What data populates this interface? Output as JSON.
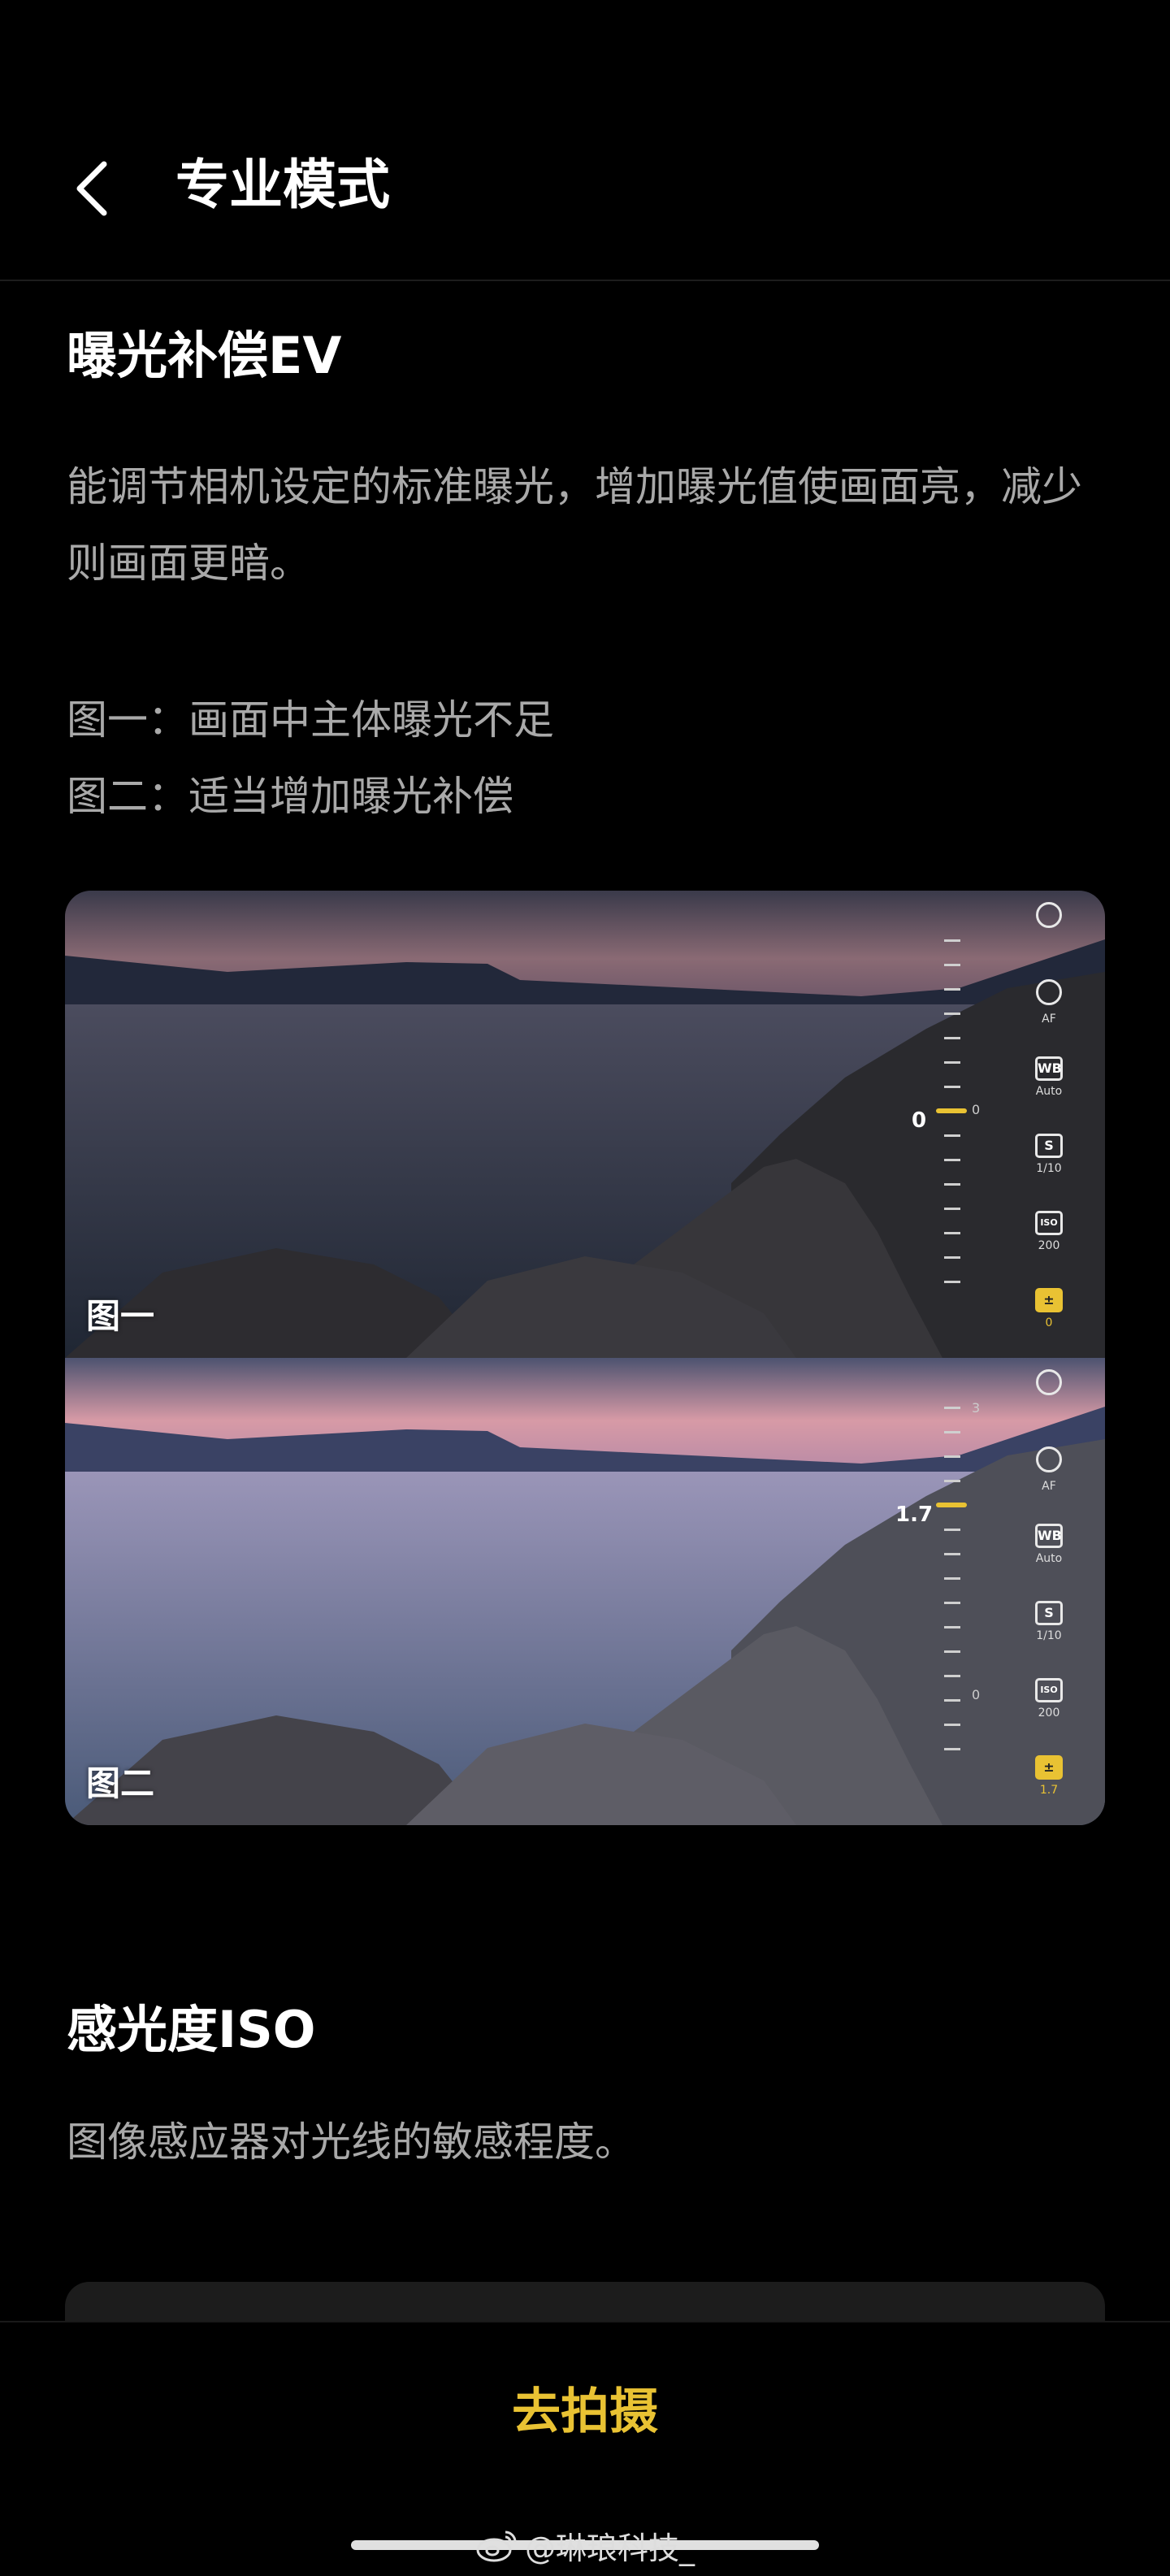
{
  "header": {
    "title": "专业模式"
  },
  "exposure": {
    "title": "曝光补偿EV",
    "description": "能调节相机设定的标准曝光，增加曝光值使画面亮，减少则画面更暗。",
    "caption1": "图一：画面中主体曝光不足",
    "caption2": "图二：适当增加曝光补偿",
    "photos": [
      {
        "label": "图一",
        "ev_value": "0",
        "scale_label": "0",
        "controls": [
          {
            "icon": "metering-icon",
            "glyph": "",
            "value": ""
          },
          {
            "icon": "focus-icon",
            "glyph": "",
            "value": "AF"
          },
          {
            "icon": "wb-icon",
            "glyph": "WB",
            "value": "Auto"
          },
          {
            "icon": "shutter-icon",
            "glyph": "S",
            "value": "1/10"
          },
          {
            "icon": "iso-icon",
            "glyph": "ISO",
            "value": "200"
          },
          {
            "icon": "ev-icon",
            "glyph": "±",
            "value": "0"
          }
        ]
      },
      {
        "label": "图二",
        "ev_value": "1.7",
        "scale_top": "3",
        "scale_label": "0",
        "controls": [
          {
            "icon": "metering-icon",
            "glyph": "",
            "value": ""
          },
          {
            "icon": "focus-icon",
            "glyph": "",
            "value": "AF"
          },
          {
            "icon": "wb-icon",
            "glyph": "WB",
            "value": "Auto"
          },
          {
            "icon": "shutter-icon",
            "glyph": "S",
            "value": "1/10"
          },
          {
            "icon": "iso-icon",
            "glyph": "ISO",
            "value": "200"
          },
          {
            "icon": "ev-icon",
            "glyph": "±",
            "value": "1.7"
          }
        ]
      }
    ]
  },
  "iso": {
    "title": "感光度ISO",
    "description": "图像感应器对光线的敏感程度。"
  },
  "bottom": {
    "shoot_label": "去拍摄"
  },
  "watermark": "@琳琅科技_",
  "colors": {
    "accent": "#e9c233",
    "background": "#000000",
    "secondary_text": "#a9a9a9"
  }
}
